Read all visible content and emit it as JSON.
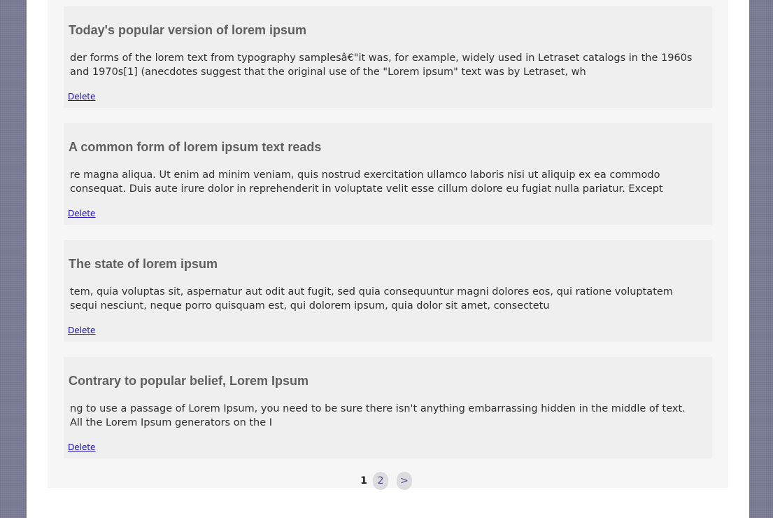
{
  "posts": [
    {
      "title": "Today's popular version of lorem ipsum",
      "body": "der forms of the lorem text from typography samplesâ€\"it was, for example, widely used in Letraset catalogs in the 1960s and 1970s[1] (anecdotes suggest that the original use of the \"Lorem ipsum\" text was by Letraset, wh",
      "delete_label": "Delete"
    },
    {
      "title": "A common form of lorem ipsum text reads",
      "body": "re magna aliqua. Ut enim ad minim veniam, quis nostrud exercitation ullamco laboris nisi ut aliquip ex ea commodo consequat. Duis aute irure dolor in reprehenderit in voluptate velit esse cillum dolore eu fugiat nulla pariatur. Except",
      "delete_label": "Delete"
    },
    {
      "title": "The state of lorem ipsum",
      "body": "tem, quia voluptas sit, aspernatur aut odit aut fugit, sed quia consequuntur magni dolores eos, qui ratione voluptatem sequi nesciunt, neque porro quisquam est, qui dolorem ipsum, quia dolor sit amet, consectetu",
      "delete_label": "Delete"
    },
    {
      "title": "Contrary to popular belief, Lorem Ipsum",
      "body": "ng to use a passage of Lorem Ipsum, you need to be sure there isn't anything embarrassing hidden in the middle of text. All the Lorem Ipsum generators on the I",
      "delete_label": "Delete"
    }
  ],
  "pagination": {
    "current": "1",
    "page_2": "2",
    "next": ">"
  }
}
